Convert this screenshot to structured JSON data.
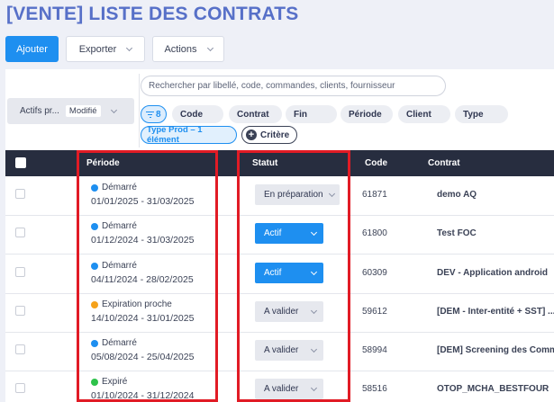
{
  "page_title": "[VENTE] LISTE DES CONTRATS",
  "toolbar": {
    "add_label": "Ajouter",
    "export_label": "Exporter",
    "actions_label": "Actions"
  },
  "filters": {
    "actifs_label": "Actifs pr...",
    "modified_badge": "Modifié",
    "search_placeholder": "Rechercher par libellé, code, commandes, clients, fournisseur",
    "count": "8",
    "chips": [
      "Code",
      "Contrat",
      "Fin",
      "Période",
      "Client",
      "Type"
    ],
    "type_prod_chip": "Type Prod – 1 élément",
    "critere_label": "Critère"
  },
  "table": {
    "columns": {
      "periode": "Période",
      "statut": "Statut",
      "code": "Code",
      "contrat": "Contrat"
    },
    "rows": [
      {
        "state": "Démarré",
        "state_color": "#1e8ff0",
        "dates": "01/01/2025 - 31/03/2025",
        "status": "En préparation",
        "status_style": "grey",
        "code": "61871",
        "contrat": "demo AQ"
      },
      {
        "state": "Démarré",
        "state_color": "#1e8ff0",
        "dates": "01/12/2024 - 31/03/2025",
        "status": "Actif",
        "status_style": "blue",
        "code": "61800",
        "contrat": "Test FOC"
      },
      {
        "state": "Démarré",
        "state_color": "#1e8ff0",
        "dates": "04/11/2024 - 28/02/2025",
        "status": "Actif",
        "status_style": "blue",
        "code": "60309",
        "contrat": "DEV - Application android"
      },
      {
        "state": "Expiration proche",
        "state_color": "#f5a21b",
        "dates": "14/10/2024 - 31/01/2025",
        "status": "A valider",
        "status_style": "grey",
        "code": "59612",
        "contrat": "[DEM - Inter-entité + SST] ..."
      },
      {
        "state": "Démarré",
        "state_color": "#1e8ff0",
        "dates": "05/08/2024 - 25/04/2025",
        "status": "A valider",
        "status_style": "grey",
        "code": "58994",
        "contrat": "[DEM] Screening des Comm"
      },
      {
        "state": "Expiré",
        "state_color": "#2ec24a",
        "dates": "01/10/2024 - 31/12/2024",
        "status": "A valider",
        "status_style": "grey",
        "code": "58516",
        "contrat": "OTOP_MCHA_BESTFOUR"
      }
    ]
  },
  "colors": {
    "accent": "#1e8ff0",
    "title": "#5770c8",
    "header_bg": "#272d3f",
    "highlight": "#e11b25"
  }
}
